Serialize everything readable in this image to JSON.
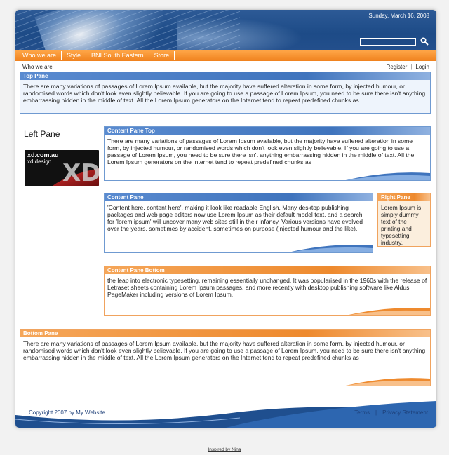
{
  "header": {
    "date": "Sunday, March 16, 2008",
    "search_placeholder": ""
  },
  "nav": {
    "items": [
      "Who we are",
      "Style",
      "BNI South Eastern",
      "Store"
    ]
  },
  "breadcrumb": "Who we are",
  "auth": {
    "register": "Register",
    "login": "Login",
    "separator": "|"
  },
  "top_pane": {
    "title": "Top Pane",
    "text": "There are many variations of passages of Lorem Ipsum available, but the majority have suffered alteration in some form, by injected humour, or randomised words which don't look even slightly believable. If you are going to use a passage of Lorem Ipsum, you need to be sure there isn't anything embarrassing hidden in the middle of text. All the Lorem Ipsum generators on the Internet tend to repeat predefined chunks as"
  },
  "left_pane": {
    "title": "Left Pane",
    "logo_line1": "xd.com.au",
    "logo_line2": "xd design",
    "logo_mark": "XD"
  },
  "content_pane_top": {
    "title": "Content Pane Top",
    "text": "There are many variations of passages of Lorem Ipsum available, but the majority have suffered alteration in some form, by injected humour, or randomised words which don't look even slightly believable. If you are going to use a passage of Lorem Ipsum, you need to be sure there isn't anything embarrassing hidden in the middle of text. All the Lorem Ipsum generators on the Internet tend to repeat predefined chunks as"
  },
  "content_pane": {
    "title": "Content Pane",
    "text": "'Content here, content here', making it look like readable English. Many desktop publishing packages and web page editors now use Lorem Ipsum as their default model text, and a search for 'lorem ipsum' will uncover many web sites still in their infancy. Various versions have evolved over the years, sometimes by accident, sometimes on purpose (injected humour and the like)."
  },
  "right_pane": {
    "title": "Right Pane",
    "text": "Lorem Ipsum is simply dummy text of the printing and typesetting industry."
  },
  "content_pane_bottom": {
    "title": "Content Pane Bottom",
    "text": "the leap into electronic typesetting, remaining essentially unchanged. It was popularised in the 1960s with the release of Letraset sheets containing Lorem Ipsum passages, and more recently with desktop publishing software like Aldus PageMaker including versions of Lorem Ipsum."
  },
  "bottom_pane": {
    "title": "Bottom Pane",
    "text": "There are many variations of passages of Lorem Ipsum available, but the majority have suffered alteration in some form, by injected humour, or randomised words which don't look even slightly believable. If you are going to use a passage of Lorem Ipsum, you need to be sure there isn't anything embarrassing hidden in the middle of text. All the Lorem Ipsum generators on the Internet tend to repeat predefined chunks as"
  },
  "footer": {
    "copyright": "Copyright 2007 by My Website",
    "terms": "Terms",
    "separator": "|",
    "privacy": "Privacy Statement"
  },
  "inspired": "Inspired by Nina",
  "colors": {
    "header_blue": "#1d4b87",
    "nav_orange": "#f0821e",
    "pane_blue": "#3f74bd",
    "pane_orange": "#ee8a2e",
    "footer_blue": "#1f4f8f"
  },
  "icons": {
    "search": "search-icon"
  }
}
